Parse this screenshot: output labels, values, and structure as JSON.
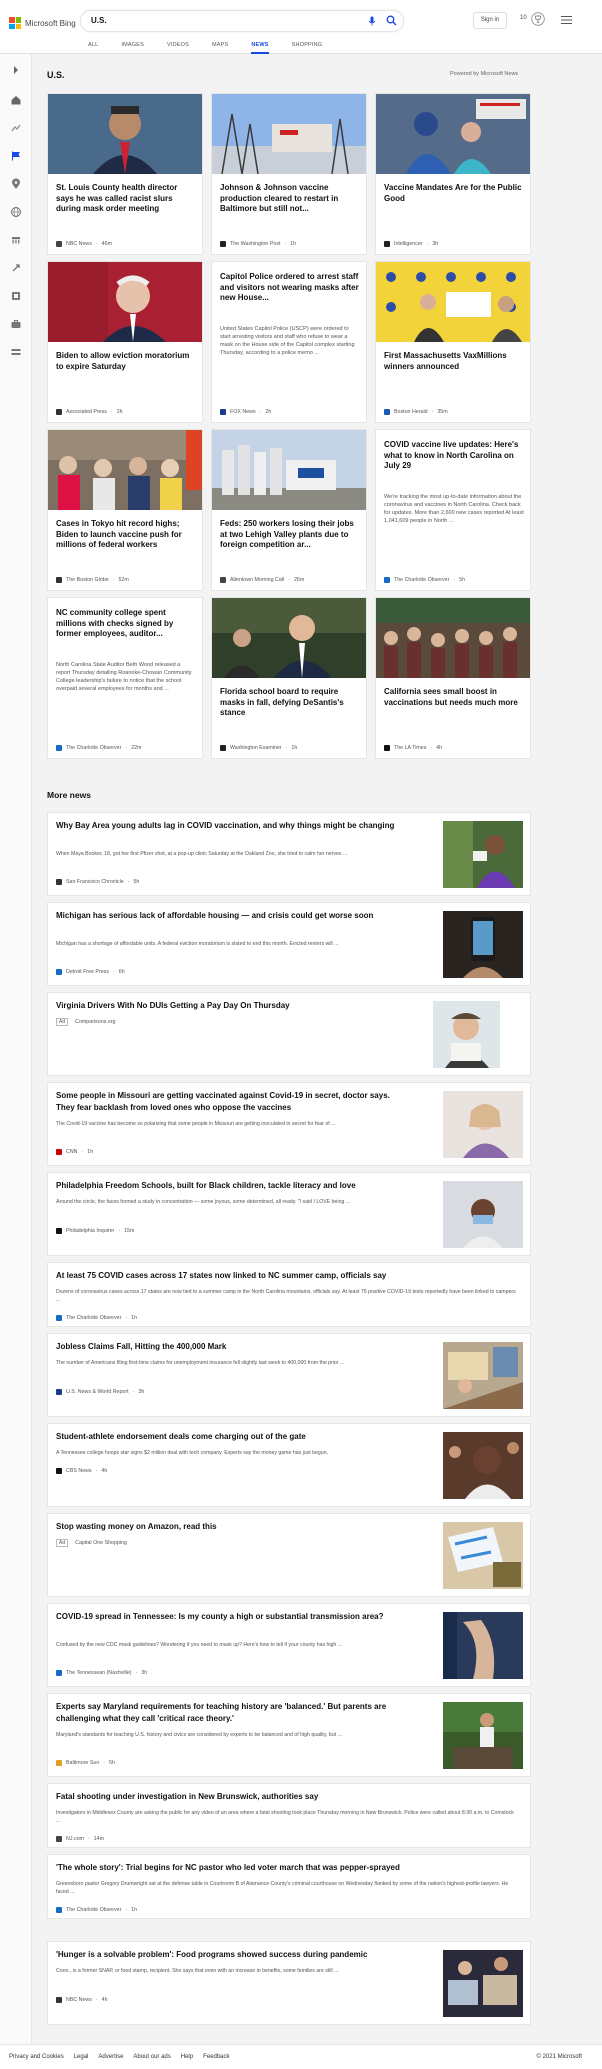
{
  "header": {
    "logo_text": "Microsoft Bing",
    "search_value": "U.S.",
    "signin_label": "Sign in",
    "rewards_count": "10"
  },
  "tabs": [
    "ALL",
    "IMAGES",
    "VIDEOS",
    "MAPS",
    "NEWS",
    "SHOPPING"
  ],
  "active_tab": "NEWS",
  "page": {
    "title": "U.S.",
    "powered_by": "Powered by Microsoft News"
  },
  "top_stories": [
    {
      "title": "St. Louis County health director says he was called racist slurs during mask order meeting",
      "snippet": "",
      "source": "NBC News",
      "time": "46m"
    },
    {
      "title": "Johnson & Johnson vaccine production cleared to restart in Baltimore but still not...",
      "snippet": "",
      "source": "The Washington Post",
      "time": "1h"
    },
    {
      "title": "Vaccine Mandates Are for the Public Good",
      "snippet": "",
      "source": "Intelligencer",
      "time": "3h"
    },
    {
      "title": "Biden to allow eviction moratorium to expire Saturday",
      "snippet": "",
      "source": "Associated Press",
      "time": "2h"
    },
    {
      "title": "Capitol Police ordered to arrest staff and visitors not wearing masks after new House...",
      "snippet": "United States Capitol Police (USCP) were ordered to start arresting visitors and staff who refuse to wear a mask on the House side of the Capitol complex starting Thursday, according to a police memo ...",
      "source": "FOX News",
      "time": "2h"
    },
    {
      "title": "First Massachusetts VaxMillions winners announced",
      "snippet": "",
      "source": "Boston Herald",
      "time": "35m"
    },
    {
      "title": "Cases in Tokyo hit record highs; Biden to launch vaccine push for millions of federal workers",
      "snippet": "",
      "source": "The Boston Globe",
      "time": "52m"
    },
    {
      "title": "Feds: 250 workers losing their jobs at two Lehigh Valley plants due to foreign competition ar...",
      "snippet": "",
      "source": "Allentown Morning Call",
      "time": "26m"
    },
    {
      "title": "COVID vaccine live updates: Here's what to know in North Carolina on July 29",
      "snippet": "We're tracking the most up-to-date information about the coronavirus and vaccines in North Carolina. Check back for updates. More than 2,600 new cases reported At least 1,041,609 people in North ...",
      "source": "The Charlotte Observer",
      "time": "5h"
    },
    {
      "title": "NC community college spent millions with checks signed by former employees, auditor...",
      "snippet": "North Carolina State Auditor Beth Wood released a report Thursday detailing Roanoke-Chowan Community College leadership's failure to notice that the school overpaid several employees for months and ...",
      "source": "The Charlotte Observer",
      "time": "22m"
    },
    {
      "title": "Florida school board to require masks in fall, defying DeSantis's stance",
      "snippet": "",
      "source": "Washington Examiner",
      "time": "1h"
    },
    {
      "title": "California sees small boost in vaccinations but needs much more",
      "snippet": "",
      "source": "The LA Times",
      "time": "4h"
    }
  ],
  "more_news_title": "More news",
  "more_news": [
    {
      "title": "Why Bay Area young adults lag in COVID vaccination, and why things might be changing",
      "snippet": "When Maya Booker, 18, got her first Pfizer shot, at a pop-up clinic Saturday at the Oakland Zoo, she tried to calm her nerves ...",
      "source": "San Francisco Chronicle",
      "time": "5h",
      "ad": false
    },
    {
      "title": "Michigan has serious lack of affordable housing — and crisis could get worse soon",
      "snippet": "Michigan has a shortage of affordable units. A federal eviction moratorium is slated to end this month. Evicted renters will ...",
      "source": "Detroit Free Press",
      "time": "6h",
      "ad": false
    },
    {
      "title": "Virginia Drivers With No DUIs Getting a Pay Day On Thursday",
      "snippet": "",
      "source": "Comparisons.org",
      "time": "",
      "ad": true,
      "ad_label": "Ad"
    },
    {
      "title": "Some people in Missouri are getting vaccinated against Covid-19 in secret, doctor says. They fear backlash from loved ones who oppose the vaccines",
      "snippet": "The Covid-19 vaccine has become so polarizing that some people in Missouri are getting inoculated in secret for fear of ...",
      "source": "CNN",
      "time": "1h",
      "ad": false
    },
    {
      "title": "Philadelphia Freedom Schools, built for Black children, tackle literacy and love",
      "snippet": "Around the circle, the faces formed a study in concentration — some joyous, some determined, all ready. \"I said I LOVE being ...",
      "source": "Philadelphia Inquirer",
      "time": "15m",
      "ad": false
    },
    {
      "title": "At least 75 COVID cases across 17 states now linked to NC summer camp, officials say",
      "snippet": "Dozens of coronavirus cases across 17 states are now tied to a summer camp in the North Carolina mountains, officials say. At least 75 positive COVID-19 tests reportedly have been linked to campers ...",
      "source": "The Charlotte Observer",
      "time": "1h",
      "ad": false
    },
    {
      "title": "Jobless Claims Fall, Hitting the 400,000 Mark",
      "snippet": "The number of Americans filing first-time claims for unemployment insurance fell slightly last week to 400,000 from the prior ...",
      "source": "U.S. News & World Report",
      "time": "3h",
      "ad": false
    },
    {
      "title": "Student-athlete endorsement deals come charging out of the gate",
      "snippet": "A Tennessee college hoops star signs $2 million deal with tech company. Experts say the money game has just begun.",
      "source": "CBS News",
      "time": "4h",
      "ad": false
    },
    {
      "title": "Stop wasting money on Amazon, read this",
      "snippet": "",
      "source": "Capital One Shopping",
      "time": "",
      "ad": true,
      "ad_label": "Ad"
    },
    {
      "title": "COVID-19 spread in Tennessee: Is my county a high or substantial transmission area?",
      "snippet": "Confused by the new CDC mask guidelines? Wondering if you need to mask up? Here's how to tell if your county has high ...",
      "source": "The Tennessean (Nashville)",
      "time": "3h",
      "ad": false
    },
    {
      "title": "Experts say Maryland requirements for teaching history are 'balanced.' But parents are challenging what they call 'critical race theory.'",
      "snippet": "Maryland's standards for teaching U.S. history and civics are considered by experts to be balanced and of high quality, but ...",
      "source": "Baltimore Sun",
      "time": "5h",
      "ad": false
    },
    {
      "title": "Fatal shooting under investigation in New Brunswick, authorities say",
      "snippet": "Investigators in Middlesex County are asking the public for any video of an area where a fatal shooting took place Thursday morning in New Brunswick. Police were called about 8:30 a.m. to Comstock ...",
      "source": "NJ.com",
      "time": "14m",
      "ad": false
    },
    {
      "title": "'The whole story': Trial begins for NC pastor who led voter march that was pepper-sprayed",
      "snippet": "Greensboro pastor Gregory Drumwright sat at the defense table in Courtroom B of Alamance County's criminal courthouse on Wednesday flanked by some of the nation's highest-profile lawyers. He faced ...",
      "source": "The Charlotte Observer",
      "time": "1h",
      "ad": false
    },
    {
      "title": "'Hunger is a solvable problem': Food programs showed success during pandemic",
      "snippet": "Conn., is a former SNAP, or food stamp, recipient. She says that even with an increase in benefits, some families are still ...",
      "source": "NBC News",
      "time": "4h",
      "ad": false
    }
  ],
  "footer": {
    "links": [
      "Privacy and Cookies",
      "Legal",
      "Advertise",
      "About our ads",
      "Help",
      "Feedback"
    ],
    "copyright": "© 2021 Microsoft"
  },
  "colors": {
    "accent": "#174ae4",
    "ms_red": "#f25022",
    "ms_green": "#7fba00",
    "ms_blue": "#00a4ef",
    "ms_yellow": "#ffb900"
  }
}
